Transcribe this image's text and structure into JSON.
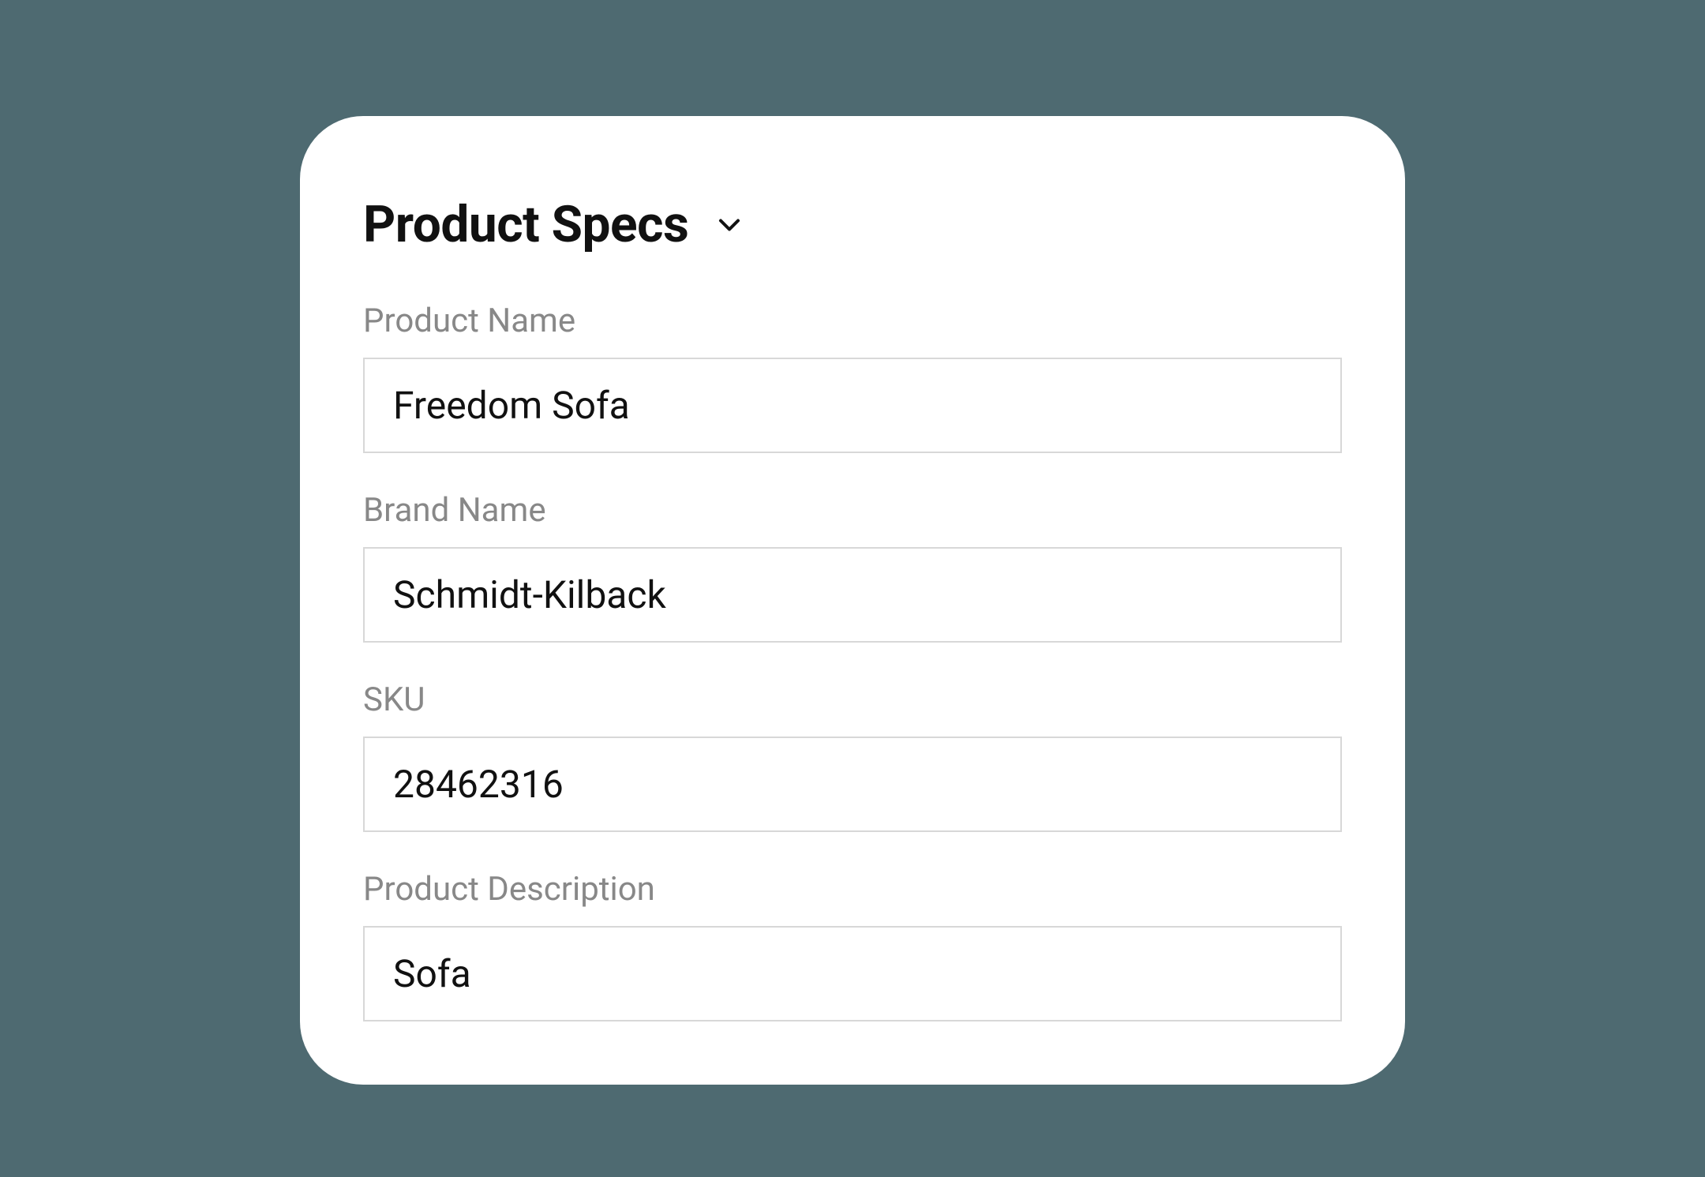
{
  "card": {
    "title": "Product Specs"
  },
  "fields": {
    "product_name": {
      "label": "Product Name",
      "value": "Freedom Sofa"
    },
    "brand_name": {
      "label": "Brand Name",
      "value": "Schmidt-Kilback"
    },
    "sku": {
      "label": "SKU",
      "value": "28462316"
    },
    "product_description": {
      "label": "Product Description",
      "value": "Sofa"
    }
  }
}
